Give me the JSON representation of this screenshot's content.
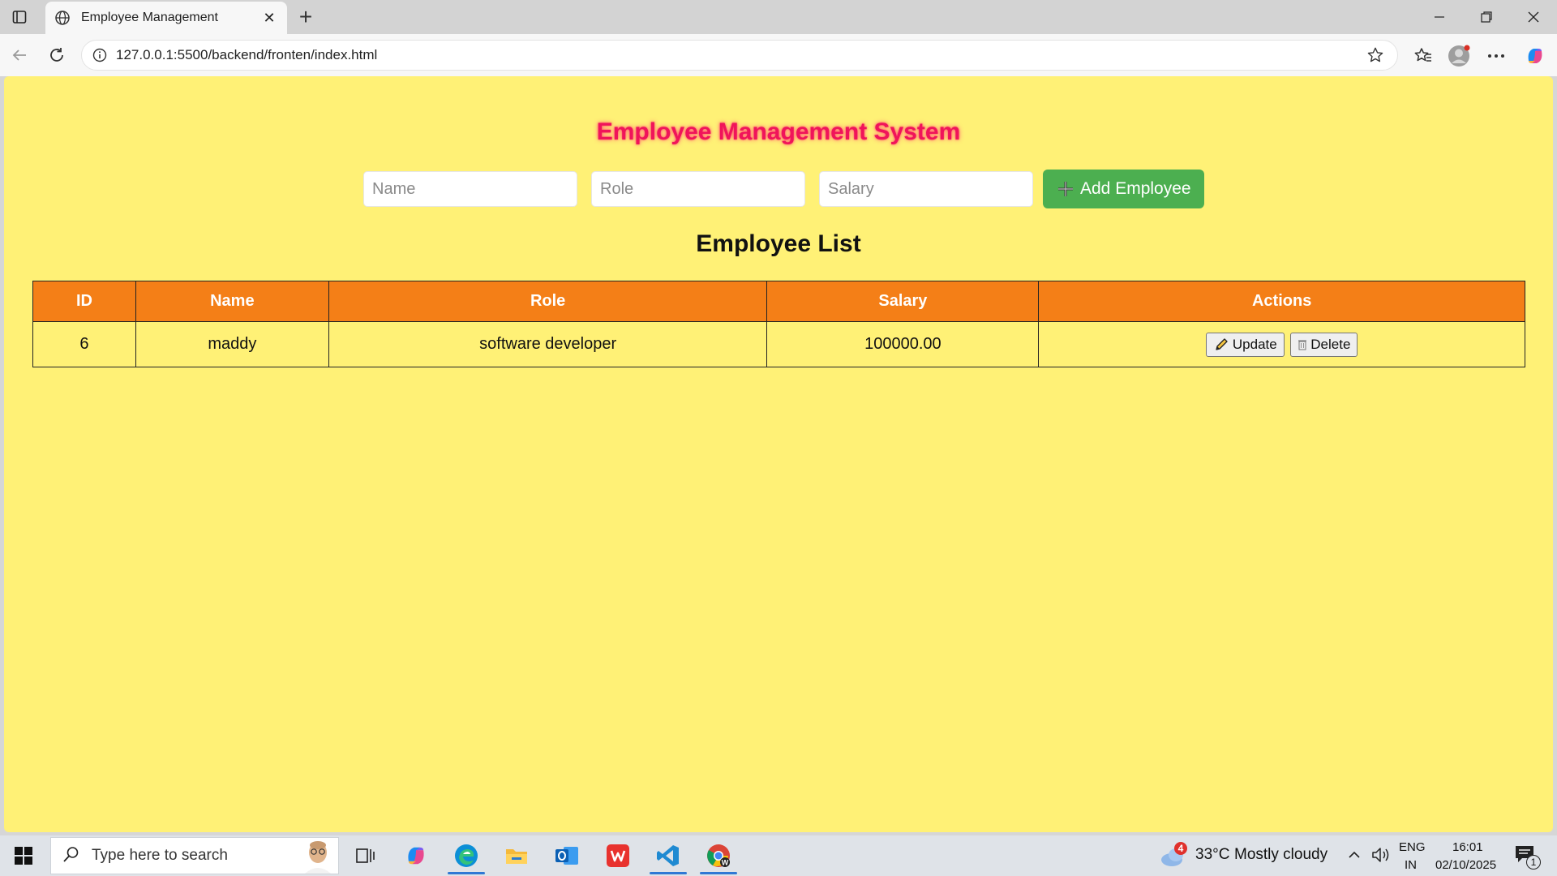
{
  "browser": {
    "tab_title": "Employee Management",
    "url": "127.0.0.1:5500/backend/fronten/index.html",
    "new_tab_symbol": "+",
    "close_symbol": "✕"
  },
  "page": {
    "title": "Employee Management System",
    "form": {
      "name_placeholder": "Name",
      "role_placeholder": "Role",
      "salary_placeholder": "Salary",
      "add_label": "Add Employee"
    },
    "list_title": "Employee List",
    "columns": [
      "ID",
      "Name",
      "Role",
      "Salary",
      "Actions"
    ],
    "rows": [
      {
        "id": "6",
        "name": "maddy",
        "role": "software developer",
        "salary": "100000.00"
      }
    ],
    "actions": {
      "update_label": "Update",
      "delete_label": "Delete"
    }
  },
  "taskbar": {
    "search_placeholder": "Type here to search",
    "weather_badge": "4",
    "weather_temp": "33°C",
    "weather_desc": "Mostly cloudy",
    "lang_top": "ENG",
    "lang_bottom": "IN",
    "time": "16:01",
    "date": "02/10/2025",
    "notifications": "1"
  },
  "colors": {
    "page_bg": "#fff176",
    "title": "#f0145a",
    "table_header": "#f47f17",
    "add_button": "#4caf50"
  }
}
